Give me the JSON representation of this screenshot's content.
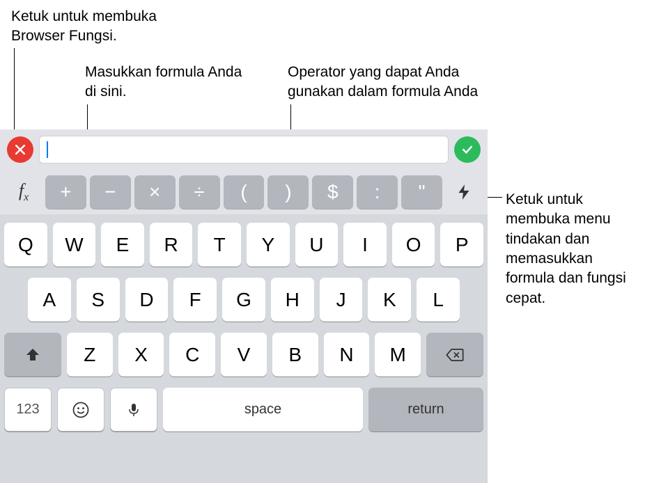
{
  "callouts": {
    "fx": "Ketuk untuk membuka Browser Fungsi.",
    "formula_input": "Masukkan formula Anda di sini.",
    "operators": "Operator yang dapat Anda gunakan dalam formula Anda",
    "quick": "Ketuk untuk membuka menu tindakan dan memasukkan formula dan fungsi cepat."
  },
  "formula_bar": {
    "cancel_icon": "close-icon",
    "ok_icon": "checkmark-icon",
    "input_value": ""
  },
  "operator_row": {
    "fx_label": "f",
    "fx_sub": "x",
    "ops": [
      "+",
      "−",
      "×",
      "÷",
      "(",
      ")",
      "$",
      ":",
      "\""
    ],
    "quick_icon": "lightning-icon"
  },
  "keyboard": {
    "row1": [
      "Q",
      "W",
      "E",
      "R",
      "T",
      "Y",
      "U",
      "I",
      "O",
      "P"
    ],
    "row2": [
      "A",
      "S",
      "D",
      "F",
      "G",
      "H",
      "J",
      "K",
      "L"
    ],
    "row3": [
      "Z",
      "X",
      "C",
      "V",
      "B",
      "N",
      "M"
    ],
    "num_label": "123",
    "space_label": "space",
    "return_label": "return"
  }
}
